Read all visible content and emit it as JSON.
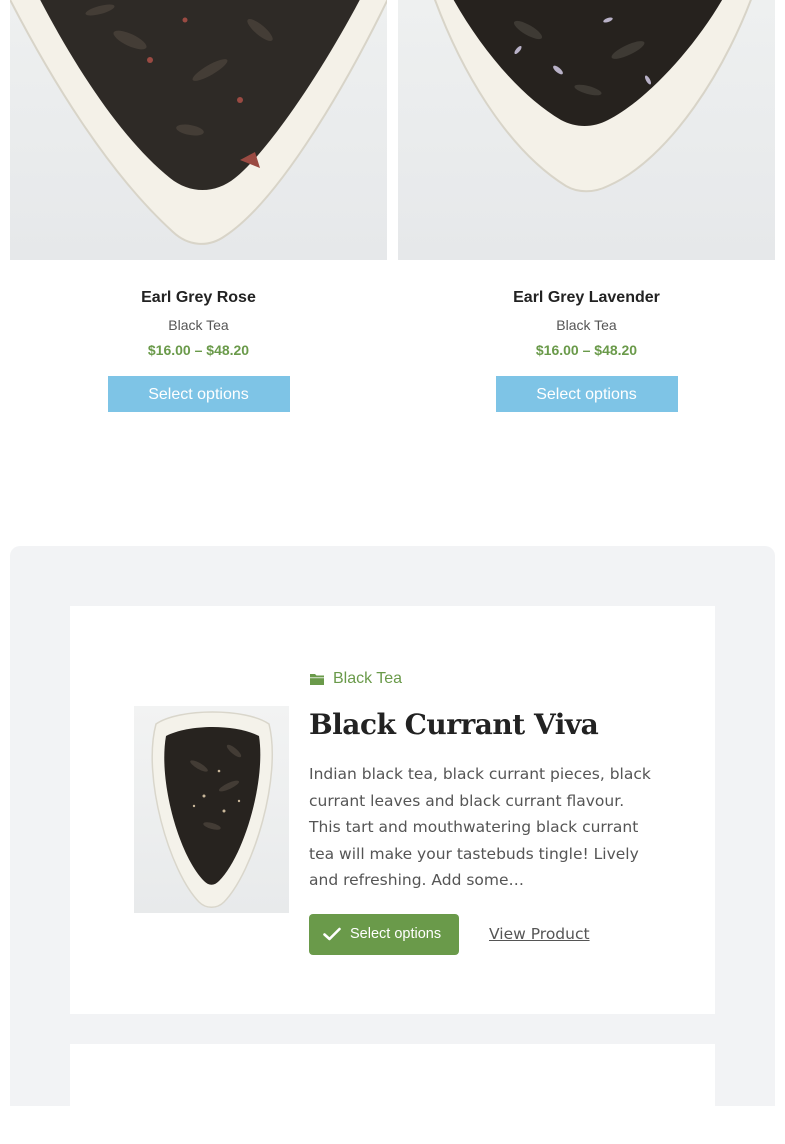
{
  "products": [
    {
      "name": "Earl Grey Rose",
      "category": "Black Tea",
      "price": "$16.00 – $48.20",
      "button": "Select options"
    },
    {
      "name": "Earl Grey Lavender",
      "category": "Black Tea",
      "price": "$16.00 – $48.20",
      "button": "Select options"
    }
  ],
  "featured": {
    "category": "Black Tea",
    "category_icon": "folder-icon",
    "title": "Black Currant Viva",
    "description": "Indian black tea, black currant pieces, black currant leaves and black currant flavour. This tart and mouthwatering black currant tea will make your tastebuds tingle! Lively and refreshing.  Add some…",
    "select_button": "Select options",
    "select_icon": "check-icon",
    "view_link": "View Product"
  },
  "colors": {
    "accent_green": "#6a9a4a",
    "button_blue": "#7ec4e6",
    "section_bg": "#f2f3f5"
  }
}
